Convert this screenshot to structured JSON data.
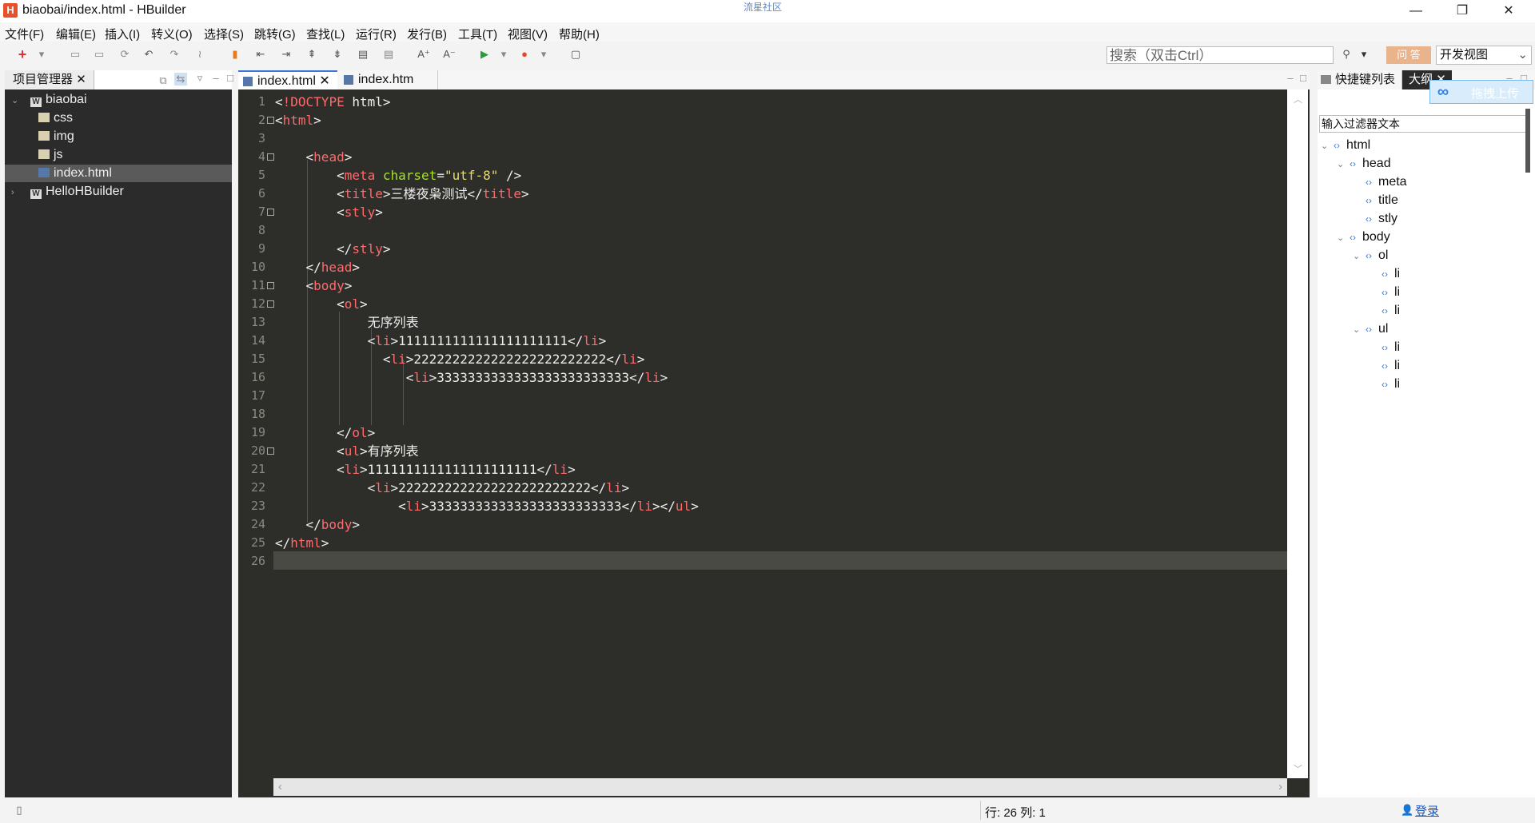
{
  "window": {
    "title": "biaobai/index.html  -  HBuilder",
    "center_text": "流星社区",
    "logo": "H"
  },
  "menu": [
    "文件(F)",
    "编辑(E)",
    "插入(I)",
    "转义(O)",
    "选择(S)",
    "跳转(G)",
    "查找(L)",
    "运行(R)",
    "发行(B)",
    "工具(T)",
    "视图(V)",
    "帮助(H)"
  ],
  "toolbar": {
    "search_placeholder": "搜索（双击Ctrl）",
    "ask_label": "问 答",
    "view_select": "开发视图"
  },
  "project": {
    "title": "项目管理器",
    "tree": [
      {
        "label": "biaobai",
        "type": "project",
        "level": 0
      },
      {
        "label": "css",
        "type": "folder",
        "level": 1
      },
      {
        "label": "img",
        "type": "folder",
        "level": 1
      },
      {
        "label": "js",
        "type": "folder",
        "level": 1
      },
      {
        "label": "index.html",
        "type": "file",
        "level": 1,
        "selected": true
      },
      {
        "label": "HelloHBuilder",
        "type": "project",
        "level": 0
      }
    ]
  },
  "editor": {
    "tabs": [
      {
        "label": "index.html",
        "active": true
      },
      {
        "label": "index.htm",
        "active": false
      }
    ],
    "lines": [
      {
        "n": "1",
        "fold": false,
        "code": "<!DOCTYPE html>"
      },
      {
        "n": "2",
        "fold": true,
        "code": "<html>"
      },
      {
        "n": "3",
        "fold": false,
        "code": ""
      },
      {
        "n": "4",
        "fold": true,
        "code": "    <head>"
      },
      {
        "n": "5",
        "fold": false,
        "code": "        <meta charset=\"utf-8\" />"
      },
      {
        "n": "6",
        "fold": false,
        "code": "        <title>三楼夜枭测试</title>"
      },
      {
        "n": "7",
        "fold": true,
        "code": "        <stly>"
      },
      {
        "n": "8",
        "fold": false,
        "code": ""
      },
      {
        "n": "9",
        "fold": false,
        "code": "        </stly>"
      },
      {
        "n": "10",
        "fold": false,
        "code": "    </head>"
      },
      {
        "n": "11",
        "fold": true,
        "code": "    <body>"
      },
      {
        "n": "12",
        "fold": true,
        "code": "        <ol>"
      },
      {
        "n": "13",
        "fold": false,
        "code": "            无序列表"
      },
      {
        "n": "14",
        "fold": false,
        "code": "            <li>1111111111111111111111</li>"
      },
      {
        "n": "15",
        "fold": false,
        "code": "              <li>2222222222222222222222222</li>"
      },
      {
        "n": "16",
        "fold": false,
        "code": "                 <li>3333333333333333333333333</li>"
      },
      {
        "n": "17",
        "fold": false,
        "code": ""
      },
      {
        "n": "18",
        "fold": false,
        "code": ""
      },
      {
        "n": "19",
        "fold": false,
        "code": "        </ol>"
      },
      {
        "n": "20",
        "fold": true,
        "code": "        <ul>有序列表"
      },
      {
        "n": "21",
        "fold": false,
        "code": "        <li>1111111111111111111111</li>"
      },
      {
        "n": "22",
        "fold": false,
        "code": "            <li>2222222222222222222222222</li>"
      },
      {
        "n": "23",
        "fold": false,
        "code": "                <li>3333333333333333333333333</li></ul>"
      },
      {
        "n": "24",
        "fold": false,
        "code": "    </body>"
      },
      {
        "n": "25",
        "fold": false,
        "code": "</html>"
      },
      {
        "n": "26",
        "fold": false,
        "code": ""
      }
    ]
  },
  "right": {
    "tab1": "快捷键列表",
    "tab2": "大纲",
    "upload_label": "拖拽上传",
    "filter_placeholder": "输入过滤器文本",
    "outline": [
      {
        "label": "html",
        "level": 0,
        "expanded": true
      },
      {
        "label": "head",
        "level": 1,
        "expanded": true
      },
      {
        "label": "meta",
        "level": 2
      },
      {
        "label": "title",
        "level": 2
      },
      {
        "label": "stly",
        "level": 2
      },
      {
        "label": "body",
        "level": 1,
        "expanded": true
      },
      {
        "label": "ol",
        "level": 2,
        "expanded": true
      },
      {
        "label": "li",
        "level": 3
      },
      {
        "label": "li",
        "level": 3
      },
      {
        "label": "li",
        "level": 3
      },
      {
        "label": "ul",
        "level": 2,
        "expanded": true
      },
      {
        "label": "li",
        "level": 3
      },
      {
        "label": "li",
        "level": 3
      },
      {
        "label": "li",
        "level": 3
      }
    ]
  },
  "status": {
    "position": "行: 26 列: 1",
    "login": "登录"
  }
}
